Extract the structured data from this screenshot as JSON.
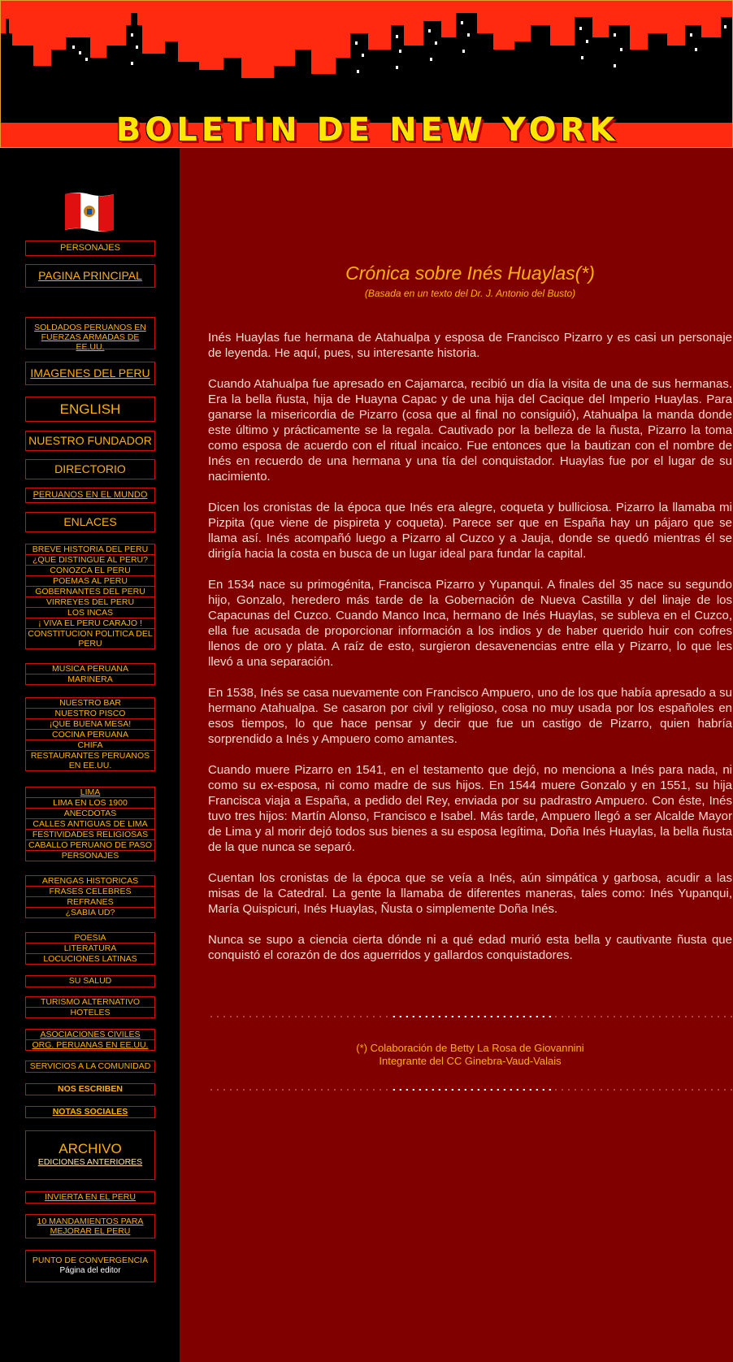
{
  "banner": {
    "title": "BOLETIN DE NEW YORK"
  },
  "sidebar": {
    "personajes": "PERSONAJES",
    "pagina_principal": "PAGINA PRINCIPAL",
    "soldados": "SOLDADOS PERUANOS EN FUERZAS ARMADAS DE EE.UU.",
    "imagenes": "IMAGENES DEL PERU",
    "english": "ENGLISH",
    "fundador": "NUESTRO FUNDADOR",
    "directorio": "DIRECTORIO",
    "peruanos_mundo": "PERUANOS EN EL MUNDO",
    "enlaces": "ENLACES",
    "group_peru": [
      "BREVE HISTORIA DEL PERU",
      "¿QUE DISTINGUE AL PERU?",
      "CONOZCA EL PERU",
      "POEMAS AL PERU",
      "GOBERNANTES DEL PERU",
      "VIRREYES DEL PERU",
      "LOS INCAS",
      "¡ VIVA EL PERU CARAJO !",
      "CONSTITUCION POLITICA DEL PERU"
    ],
    "group_musica": [
      "MUSICA PERUANA",
      "MARINERA"
    ],
    "group_bar": [
      "NUESTRO BAR",
      "NUESTRO  PISCO",
      "¡QUE BUENA MESA!",
      "COCINA PERUANA",
      "CHIFA",
      "RESTAURANTES PERUANOS EN EE.UU."
    ],
    "group_lima": [
      "LIMA",
      "LIMA EN LOS 1900",
      "ANECDOTAS",
      "CALLES ANTIGUAS DE LIMA",
      "FESTIVIDADES RELIGIOSAS",
      "CABALLO PERUANO DE PASO",
      "PERSONAJES"
    ],
    "group_arengas": [
      "ARENGAS HISTORICAS",
      "FRASES CELEBRES",
      "REFRANES",
      "¿SABIA UD?"
    ],
    "group_poesia": [
      "POESIA",
      "LITERATURA",
      "LOCUCIONES LATINAS"
    ],
    "su_salud": "SU SALUD",
    "group_turismo": [
      "TURISMO ALTERNATIVO",
      "HOTELES"
    ],
    "group_asoc": [
      "ASOCIACIONES CIVILES",
      "ORG. PERUANAS EN EE.UU."
    ],
    "servicios": "SERVICIOS A LA COMUNIDAD",
    "nos_escriben": "NOS ESCRIBEN",
    "notas_sociales": "NOTAS SOCIALES",
    "archivo_title": "ARCHIVO",
    "archivo_sub": "EDICIONES ANTERIORES",
    "invierta": "INVIERTA EN EL PERU",
    "mandamientos": "10  MANDAMIENTOS PARA MEJORAR EL PERU",
    "punto_title": "PUNTO DE CONVERGENCIA",
    "punto_sub": "Página del editor"
  },
  "article": {
    "title": "Crónica sobre Inés Huaylas(*)",
    "subtitle": "(Basada en un texto del Dr. J. Antonio del Busto)",
    "paragraphs": [
      "Inés Huaylas fue hermana de Atahualpa y esposa de Francisco Pizarro y es casi un personaje de leyenda. He aquí, pues, su interesante historia.",
      "Cuando Atahualpa fue apresado en Cajamarca, recibió un día la visita de una de sus hermanas. Era la bella ñusta, hija de Huayna Capac y de una hija del Cacique del Imperio Huaylas. Para ganarse la misericordia de Pizarro (cosa que al final no consiguió), Atahualpa la manda donde este último y prácticamente se la regala. Cautivado por la belleza de la ñusta, Pizarro la toma como esposa de acuerdo con el ritual incaico. Fue entonces que la bautizan con el nombre de Inés en recuerdo de una hermana y una tía del conquistador. Huaylas fue por el lugar de su nacimiento.",
      "Dicen los cronistas de la época que Inés era alegre, coqueta y bulliciosa. Pizarro la llamaba mi Pizpita (que viene de pispireta y coqueta). Parece ser que en España hay un pájaro que se llama así. Inés acompañó luego a Pizarro al Cuzco y a Jauja, donde se quedó mientras él se dirigía hacia la costa en busca de un lugar ideal para fundar la capital.",
      "En 1534 nace su primogénita, Francisca Pizarro y Yupanqui. A finales del 35 nace su segundo hijo, Gonzalo, heredero más tarde de la Gobernación de Nueva Castilla y del linaje de los Capacunas del Cuzco. Cuando Manco Inca, hermano de Inés Huaylas, se subleva en el Cuzco, ella fue acusada de proporcionar información a los indios y de haber querido huir con cofres llenos de oro y plata. A raíz de esto, surgieron desavenencias entre ella y Pizarro, lo que les llevó a una separación.",
      "En 1538, Inés se casa nuevamente con Francisco Ampuero, uno de los que había apresado a su hermano Atahualpa. Se casaron por civil y religioso, cosa no muy usada por los españoles en esos tiempos, lo que hace pensar y decir que fue un castigo de Pizarro, quien habría sorprendido a Inés y Ampuero como amantes.",
      "Cuando muere Pizarro en 1541, en el testamento que dejó, no menciona a Inés para nada, ni como su ex-esposa, ni como madre de sus hijos. En 1544 muere Gonzalo y en 1551, su hija Francisca viaja a España, a pedido del Rey, enviada por su padrastro Ampuero. Con éste, Inés tuvo tres hijos: Martín Alonso, Francisco e Isabel. Más tarde, Ampuero llegó a ser Alcalde Mayor de Lima y al morir dejó todos sus bienes a su esposa legítima, Doña Inés Huaylas, la bella ñusta de la que nunca se separó.",
      "Cuentan los cronistas de la época que se veía a Inés, aún simpática y garbosa, acudir a las misas de la Catedral. La gente la llamaba de diferentes maneras, tales como: Inés Yupanqui, María Quispicuri, Inés Huaylas, Ñusta o simplemente Doña Inés.",
      "Nunca se supo a ciencia cierta dónde ni a qué edad murió esta bella y cautivante ñusta que conquistó el corazón de dos aguerridos y gallardos conquistadores."
    ],
    "credit_line1": "(*) Colaboración de Betty La Rosa de Giovannini",
    "credit_line2": "Integrante del CC Ginebra-Vaud-Valais"
  }
}
